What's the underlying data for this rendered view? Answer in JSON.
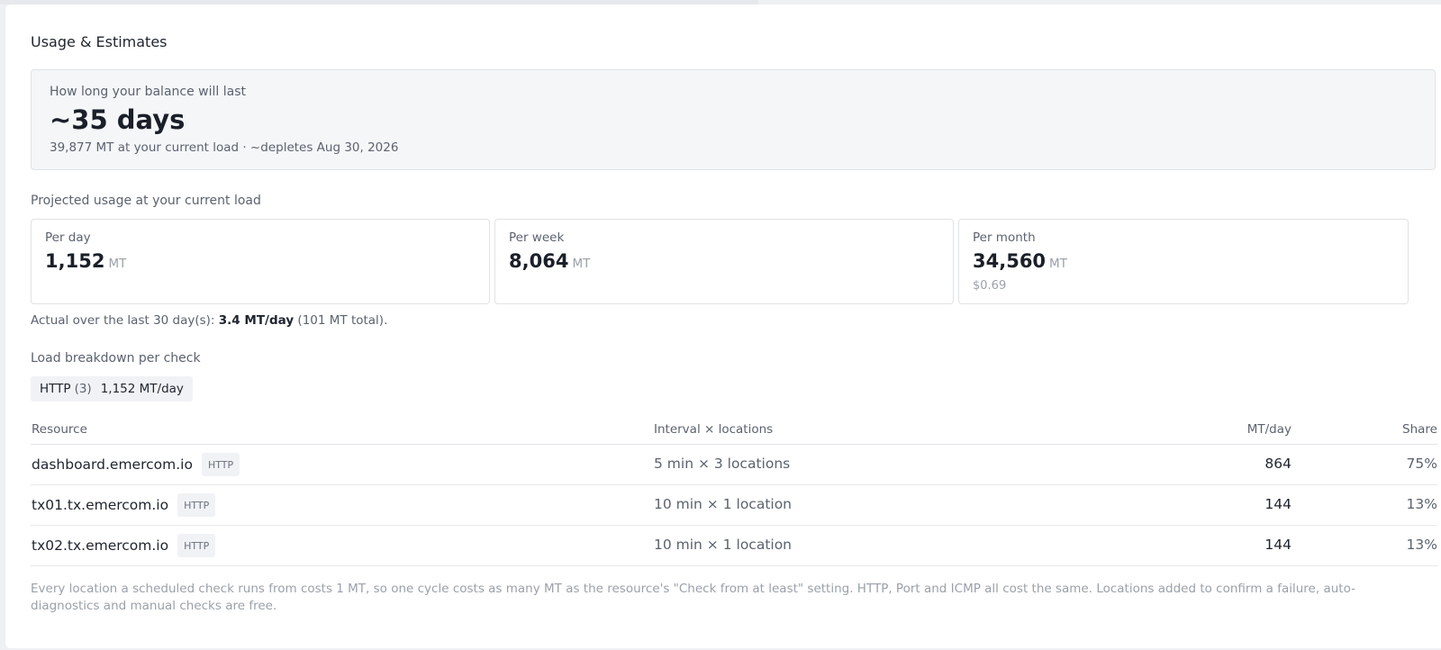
{
  "card": {
    "title": "Usage & Estimates"
  },
  "balance": {
    "label": "How long your balance will last",
    "value": "~35 days",
    "subtitle": "39,877 MT at your current load · ~depletes Aug 30, 2026"
  },
  "projected": {
    "label": "Projected usage at your current load",
    "cards": [
      {
        "label": "Per day",
        "value": "1,152",
        "unit": "MT",
        "sub": ""
      },
      {
        "label": "Per week",
        "value": "8,064",
        "unit": "MT",
        "sub": ""
      },
      {
        "label": "Per month",
        "value": "34,560",
        "unit": "MT",
        "sub": "$0.69"
      }
    ]
  },
  "actual": {
    "prefix": "Actual over the last 30 day(s): ",
    "rate": "3.4 MT/day",
    "suffix": " (101 MT total)."
  },
  "breakdown": {
    "label": "Load breakdown per check",
    "chip": {
      "type": "HTTP",
      "count": "(3)",
      "rate": "1,152 MT/day"
    }
  },
  "table": {
    "headers": {
      "resource": "Resource",
      "interval": "Interval × locations",
      "mtday": "MT/day",
      "share": "Share"
    },
    "rows": [
      {
        "resource": "dashboard.emercom.io",
        "type": "HTTP",
        "interval": "5 min × 3 locations",
        "mtday": "864",
        "share": "75%"
      },
      {
        "resource": "tx01.tx.emercom.io",
        "type": "HTTP",
        "interval": "10 min × 1 location",
        "mtday": "144",
        "share": "13%"
      },
      {
        "resource": "tx02.tx.emercom.io",
        "type": "HTTP",
        "interval": "10 min × 1 location",
        "mtday": "144",
        "share": "13%"
      }
    ]
  },
  "footnote": "Every location a scheduled check runs from costs 1 MT, so one cycle costs as many MT as the resource's \"Check from at least\" setting. HTTP, Port and ICMP all cost the same. Locations added to confirm a failure, auto-diagnostics and manual checks are free."
}
